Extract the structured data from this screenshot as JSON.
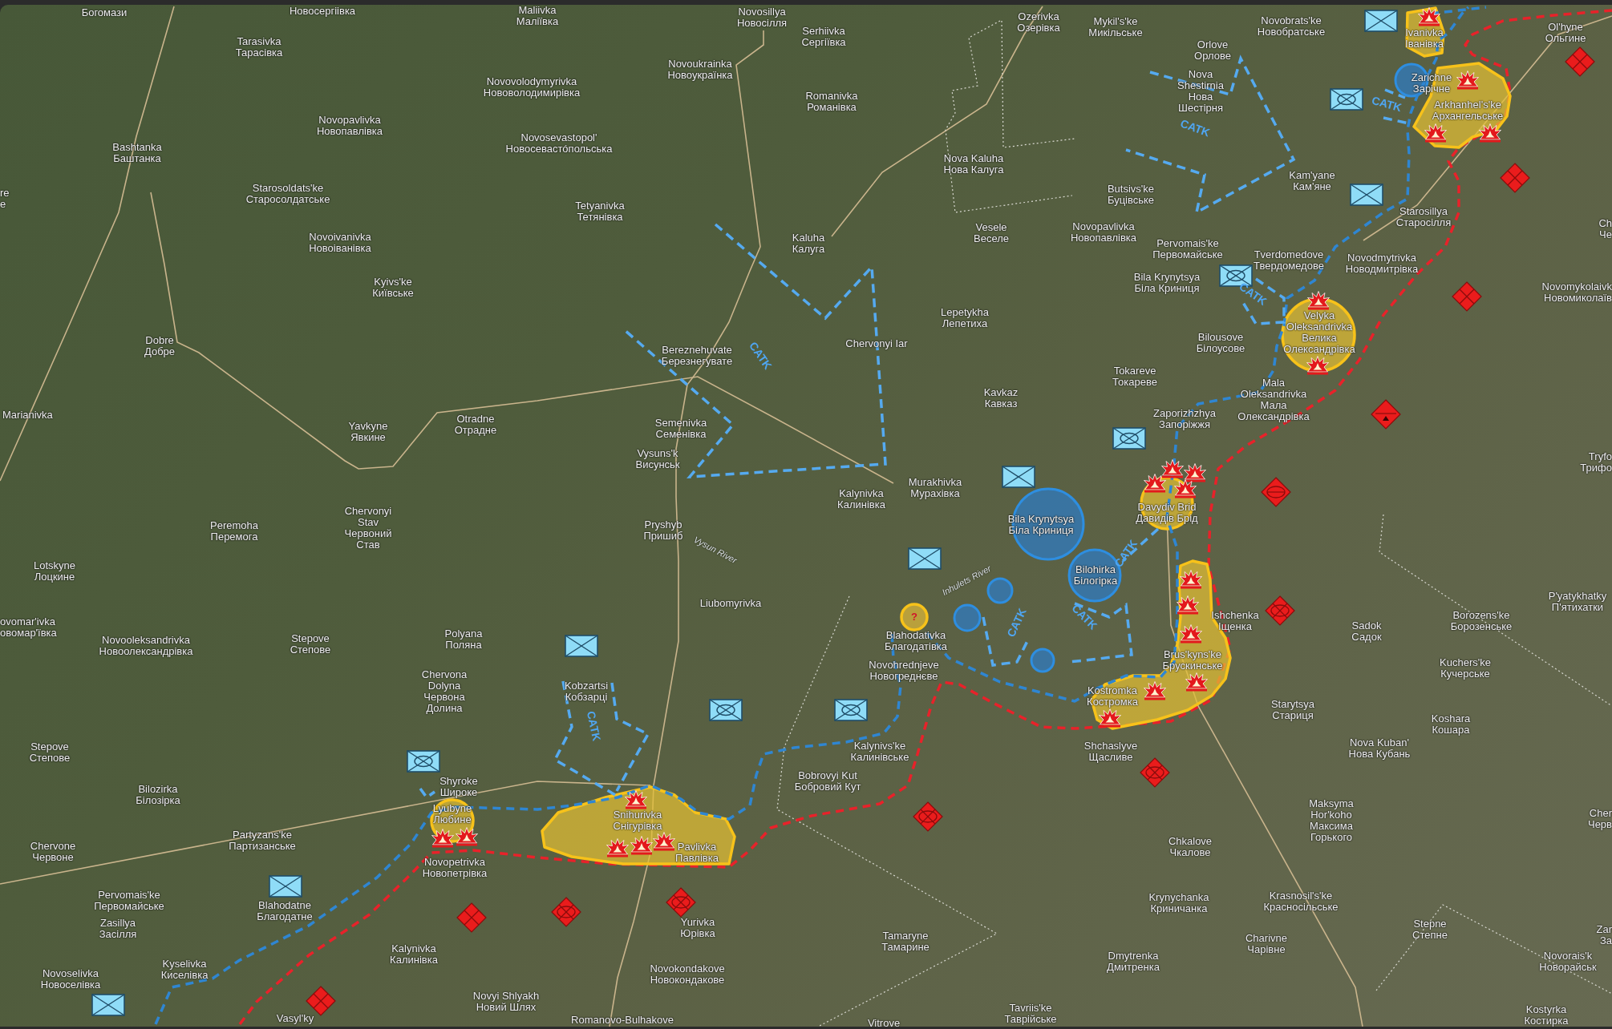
{
  "map": {
    "places": [
      {
        "lines": [
          "Богомази"
        ]
      },
      {
        "lines": [
          "Новосергіівка"
        ]
      },
      {
        "lines": [
          "Maliivka",
          "Маліївка"
        ]
      },
      {
        "lines": [
          "Novosillya",
          "Новосілля"
        ]
      },
      {
        "lines": [
          "Ozerivka",
          "Озерівка"
        ]
      },
      {
        "lines": [
          "Serhiivka",
          "Сергіївка"
        ]
      },
      {
        "lines": [
          "Mykil's'ke",
          "Микільське"
        ]
      },
      {
        "lines": [
          "Novobrats'ke",
          "Новобратське"
        ]
      },
      {
        "lines": [
          "Ivanivka",
          "Іванівка"
        ]
      },
      {
        "lines": [
          "Ol'hyne",
          "Ольгине"
        ]
      },
      {
        "lines": [
          "Tarasivka",
          "Тарасівка"
        ]
      },
      {
        "lines": [
          "Orlove",
          "Орлове"
        ]
      },
      {
        "lines": [
          "Novoukrainka",
          "Новоукраїнка"
        ]
      },
      {
        "lines": [
          "Novovolodymyrivka",
          "Нововолодимирівка"
        ]
      },
      {
        "lines": [
          "Nova",
          "Shestirnia",
          "Нова",
          "Шестірня"
        ]
      },
      {
        "lines": [
          "Zarichne",
          "Зарічне"
        ]
      },
      {
        "lines": [
          "Romanivka",
          "Романівка"
        ]
      },
      {
        "lines": [
          "Arkhanhel's'ke",
          "Архангельське"
        ]
      },
      {
        "lines": [
          "Novopavlivka",
          "Новопавлівка"
        ]
      },
      {
        "lines": [
          "Bashtanka",
          "Баштанка"
        ]
      },
      {
        "lines": [
          "Novosevastopol'",
          "Новосевастóпольська"
        ]
      },
      {
        "lines": [
          "Nova Kaluha",
          "Нова Калуга"
        ]
      },
      {
        "lines": [
          "Kam'yane",
          "Кам'яне"
        ]
      },
      {
        "lines": [
          "re",
          "е"
        ]
      },
      {
        "lines": [
          "Starosoldats'ke",
          "Старосолдатське"
        ]
      },
      {
        "lines": [
          "Butsivs'ke",
          "Буцівське"
        ]
      },
      {
        "lines": [
          "Tetyanivka",
          "Тетянівка"
        ]
      },
      {
        "lines": [
          "Starosillya",
          "Старосілля"
        ]
      },
      {
        "lines": [
          "Vesele",
          "Веселе"
        ]
      },
      {
        "lines": [
          "Novopavlivka",
          "Новопавлівка"
        ]
      },
      {
        "lines": [
          "Ch",
          "Че"
        ]
      },
      {
        "lines": [
          "Novoivanivka",
          "Новоіванівка"
        ]
      },
      {
        "lines": [
          "Kaluha",
          "Калуга"
        ]
      },
      {
        "lines": [
          "Pervomais'ke",
          "Первомайське"
        ]
      },
      {
        "lines": [
          "Tverdomedove",
          "Твердомедове"
        ]
      },
      {
        "lines": [
          "Novodmytrivka",
          "Новодмитрівка"
        ]
      },
      {
        "lines": [
          "Kyivs'ke",
          "Київське"
        ]
      },
      {
        "lines": [
          "Bila Krynytsya",
          "Біла Криниця"
        ]
      },
      {
        "lines": [
          "Novomykolaivk",
          "Новомиколаїв"
        ]
      },
      {
        "lines": [
          "Lepetykha",
          "Лепетиха"
        ]
      },
      {
        "lines": [
          "Dobre",
          "Добре"
        ]
      },
      {
        "lines": [
          "Bereznehuvate",
          "Березнегувате"
        ]
      },
      {
        "lines": [
          "Chervonyi Iar"
        ]
      },
      {
        "lines": [
          "Bilousove",
          "Білоусове"
        ]
      },
      {
        "lines": [
          "Velyka",
          "Oleksandrivka",
          "Велика",
          "Олександрівка"
        ]
      },
      {
        "lines": [
          "Tokareve",
          "Токареве"
        ]
      },
      {
        "lines": [
          "Kavkaz",
          "Кавказ"
        ]
      },
      {
        "lines": [
          "Marianivka"
        ]
      },
      {
        "lines": [
          "Yavkyne",
          "Явкине"
        ]
      },
      {
        "lines": [
          "Otradne",
          "Отрадне"
        ]
      },
      {
        "lines": [
          "Semenivka",
          "Семенівка"
        ]
      },
      {
        "lines": [
          "Zaporizhzhya",
          "Запоріжжя"
        ]
      },
      {
        "lines": [
          "Mala",
          "Oleksandrivka",
          "Мала",
          "Олександрівка"
        ]
      },
      {
        "lines": [
          "Vysuns'k",
          "Висунськ"
        ]
      },
      {
        "lines": [
          "Tryfo",
          "Трифо"
        ]
      },
      {
        "lines": [
          "Kalynivka",
          "Калинівка"
        ]
      },
      {
        "lines": [
          "Murakhivka",
          "Мурахівка"
        ]
      },
      {
        "lines": [
          "Peremoha",
          "Перемога"
        ]
      },
      {
        "lines": [
          "Chervonyi",
          "Stav",
          "Червоний",
          "Став"
        ]
      },
      {
        "lines": [
          "Pryshyb",
          "Пришиб"
        ]
      },
      {
        "lines": [
          "Bila Krynytsya",
          "Біла Криниця"
        ]
      },
      {
        "lines": [
          "Davydiv Brid",
          "Давидів Брід"
        ]
      },
      {
        "lines": [
          "Lotskyne",
          "Лоцкине"
        ]
      },
      {
        "lines": [
          "Bilohirka",
          "Білогірка"
        ]
      },
      {
        "lines": [
          "Liubomyrivka"
        ]
      },
      {
        "lines": [
          "P'yatykhatky",
          "П'ятихатки"
        ]
      },
      {
        "lines": [
          "ovomar'ivka",
          "овомар'ївка"
        ]
      },
      {
        "lines": [
          "Ishchenka",
          "Іщенка"
        ]
      },
      {
        "lines": [
          "Sadok",
          "Садок"
        ]
      },
      {
        "lines": [
          "Borozens'ke",
          "Борозенське"
        ]
      },
      {
        "lines": [
          "Novooleksandrivka",
          "Новоолександрівка"
        ]
      },
      {
        "lines": [
          "Stepove",
          "Степове"
        ]
      },
      {
        "lines": [
          "Polyana",
          "Поляна"
        ]
      },
      {
        "lines": [
          "Blahodativka",
          "Благодатівка"
        ]
      },
      {
        "lines": [
          "Novohrednjeve",
          "Новогреднєве"
        ]
      },
      {
        "lines": [
          "Brus'kyns'ke",
          "Брускинське"
        ]
      },
      {
        "lines": [
          "Kuchers'ke",
          "Кучерське"
        ]
      },
      {
        "lines": [
          "Chervona",
          "Dolyna",
          "Червона",
          "Долина"
        ]
      },
      {
        "lines": [
          "Kobzartsi",
          "Кобзарці"
        ]
      },
      {
        "lines": [
          "Kostromka",
          "Костромка"
        ]
      },
      {
        "lines": [
          "Starytsya",
          "Стариця"
        ]
      },
      {
        "lines": [
          "Koshara",
          "Кошара"
        ]
      },
      {
        "lines": [
          "Stepove",
          "Степове"
        ]
      },
      {
        "lines": [
          "Kalynivs'ke",
          "Калинівське"
        ]
      },
      {
        "lines": [
          "Shchaslyve",
          "Щасливе"
        ]
      },
      {
        "lines": [
          "Nova Kuban'",
          "Нова Кубань"
        ]
      },
      {
        "lines": [
          "Bilozirka",
          "Білозірка"
        ]
      },
      {
        "lines": [
          "Shyroke",
          "Широке"
        ]
      },
      {
        "lines": [
          "Bobrovyi Kut",
          "Бобровий Кут"
        ]
      },
      {
        "lines": [
          "Lyubyne",
          "Любине"
        ]
      },
      {
        "lines": [
          "Snihurivka",
          "Снігурівка"
        ]
      },
      {
        "lines": [
          "Maksyma",
          "Hor'koho",
          "Максима",
          "Горького"
        ]
      },
      {
        "lines": [
          "Cher",
          "Черв"
        ]
      },
      {
        "lines": [
          "Chervone",
          "Червоне"
        ]
      },
      {
        "lines": [
          "Partyzans'ke",
          "Партизанське"
        ]
      },
      {
        "lines": [
          "Novopetrivka",
          "Новопетрівка"
        ]
      },
      {
        "lines": [
          "Pavlivka",
          "Павлівка"
        ]
      },
      {
        "lines": [
          "Chkalove",
          "Чкалове"
        ]
      },
      {
        "lines": [
          "Pervomais'ke",
          "Первомайське"
        ]
      },
      {
        "lines": [
          "Blahodatne",
          "Благодатне"
        ]
      },
      {
        "lines": [
          "Krynychanka",
          "Криничанка"
        ]
      },
      {
        "lines": [
          "Krasnosil's'ke",
          "Красносільське"
        ]
      },
      {
        "lines": [
          "Zasillya",
          "Засілля"
        ]
      },
      {
        "lines": [
          "Yurivka",
          "Юрівка"
        ]
      },
      {
        "lines": [
          "Stepne",
          "Степне"
        ]
      },
      {
        "lines": [
          "Zar",
          "За"
        ]
      },
      {
        "lines": [
          "Tamaryne",
          "Тамарине"
        ]
      },
      {
        "lines": [
          "Charivne",
          "Чарівне"
        ]
      },
      {
        "lines": [
          "Kalynivka",
          "Калинівка"
        ]
      },
      {
        "lines": [
          "Dmytrenka",
          "Дмитренка"
        ]
      },
      {
        "lines": [
          "Novorais'k",
          "Новорайськ"
        ]
      },
      {
        "lines": [
          "Novoselivka",
          "Новоселівка"
        ]
      },
      {
        "lines": [
          "Kyselivka",
          "Киселівка"
        ]
      },
      {
        "lines": [
          "Novokondakove",
          "Новокондакове"
        ]
      },
      {
        "lines": [
          "Novyi Shlyakh",
          "Новий Шлях"
        ]
      },
      {
        "lines": [
          "Vasyl'ky"
        ]
      },
      {
        "lines": [
          "Romanovo-Bulhakove"
        ]
      },
      {
        "lines": [
          "Vitrove"
        ]
      },
      {
        "lines": [
          "Tavriis'ke",
          "Таврійське"
        ]
      },
      {
        "lines": [
          "Kostyrka",
          "Костирка"
        ]
      }
    ],
    "attack_labels": [
      {
        "text": "CATK"
      },
      {
        "text": "CATK"
      },
      {
        "text": "CATK"
      },
      {
        "text": "CATK"
      },
      {
        "text": "CATK"
      },
      {
        "text": "CATK"
      },
      {
        "text": "CATK"
      },
      {
        "text": "CATK"
      }
    ],
    "river_labels": [
      {
        "text": "Vysun River"
      },
      {
        "text": "Inhulets River"
      }
    ],
    "unknown_marker": "?"
  }
}
